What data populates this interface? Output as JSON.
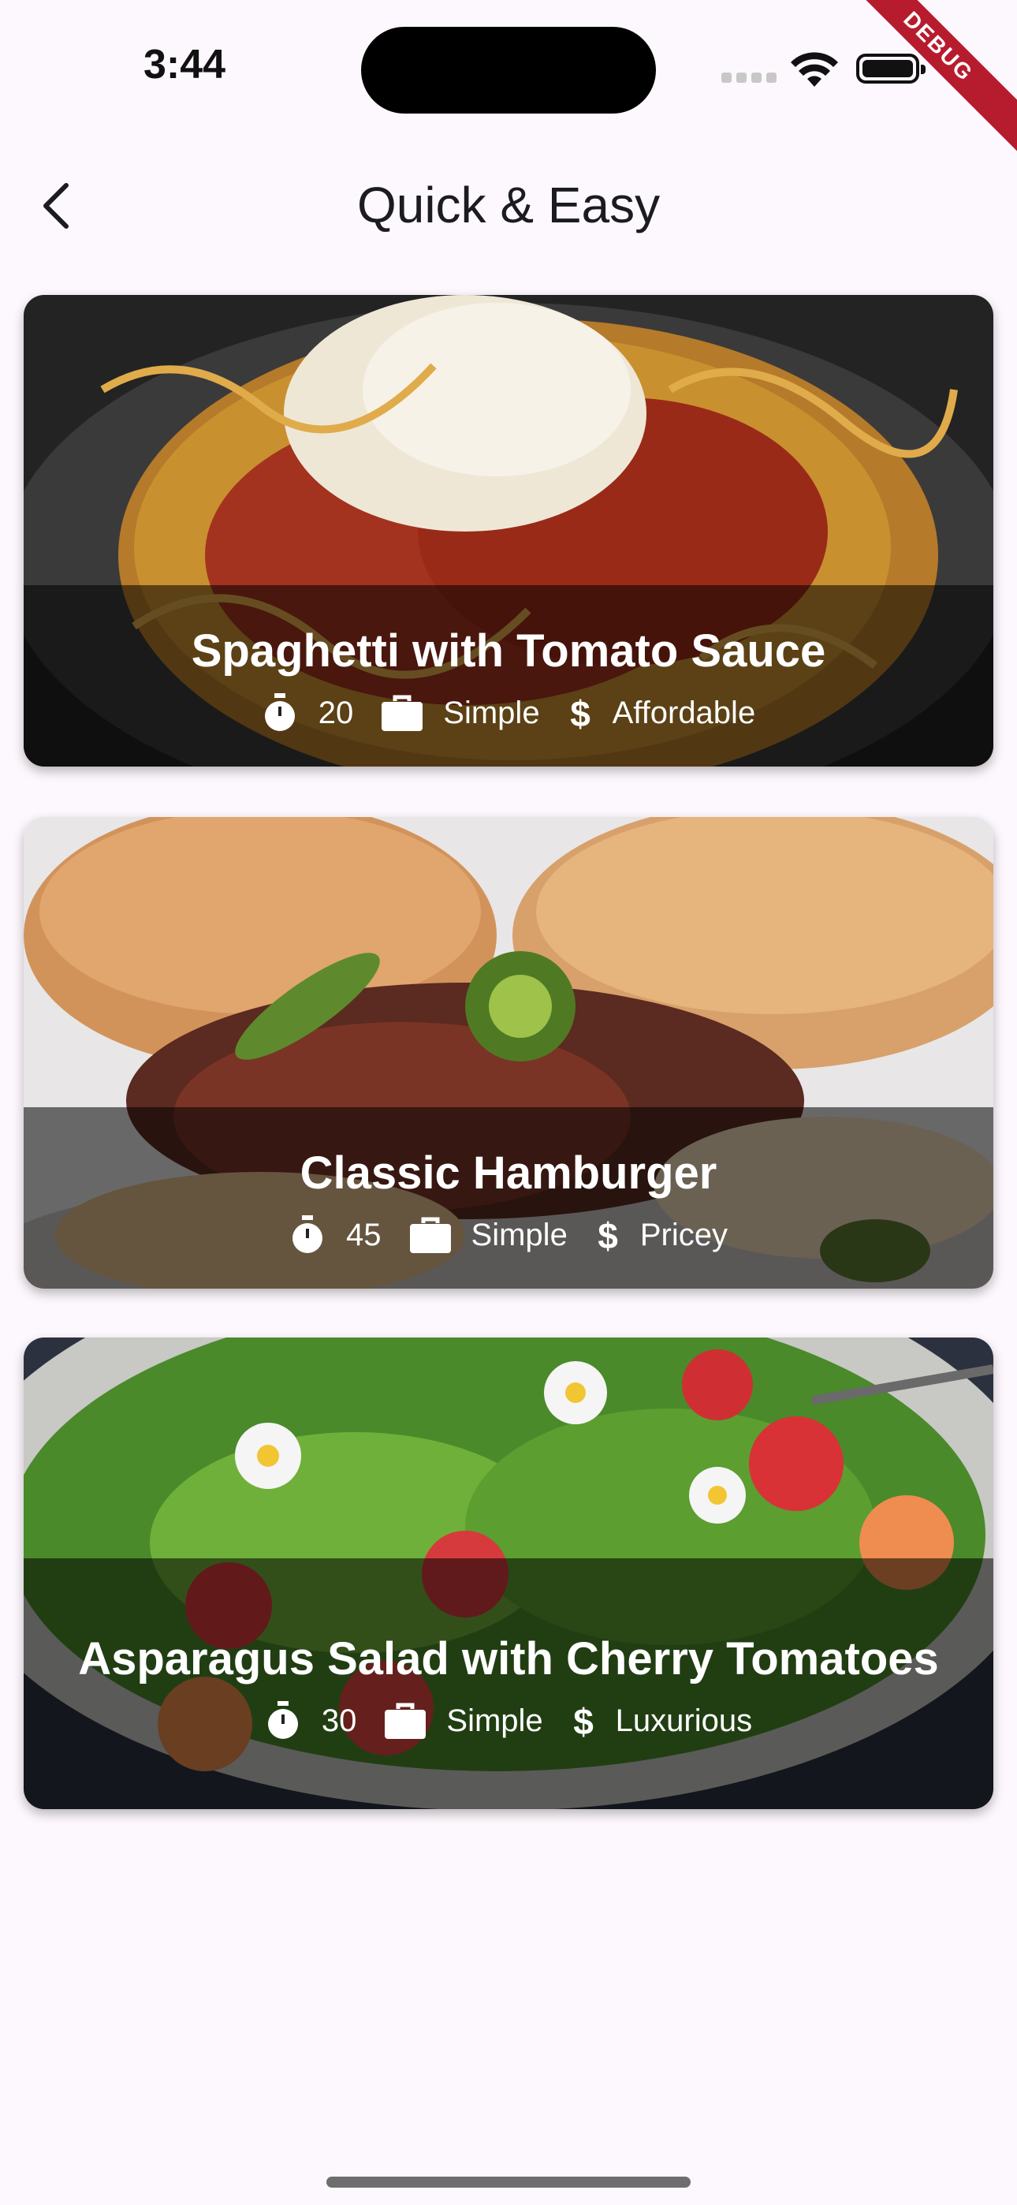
{
  "status_bar": {
    "time": "3:44"
  },
  "debug_banner": "DEBUG",
  "app_bar": {
    "title": "Quick & Easy",
    "back_icon": "chevron-left-icon"
  },
  "meals": [
    {
      "title": "Spaghetti with Tomato Sauce",
      "duration": "20",
      "complexity": "Simple",
      "affordability": "Affordable",
      "image": "spaghetti-photo"
    },
    {
      "title": "Classic Hamburger",
      "duration": "45",
      "complexity": "Simple",
      "affordability": "Pricey",
      "image": "hamburger-photo"
    },
    {
      "title": "Asparagus Salad with Cherry Tomatoes",
      "duration": "30",
      "complexity": "Simple",
      "affordability": "Luxurious",
      "image": "asparagus-salad-photo"
    }
  ],
  "icons": {
    "duration": "stopwatch-icon",
    "complexity": "briefcase-icon",
    "affordability": "dollar-icon"
  },
  "colors": {
    "background": "#fdf8fd",
    "overlay": "#000000",
    "debug": "#b71c2e"
  }
}
